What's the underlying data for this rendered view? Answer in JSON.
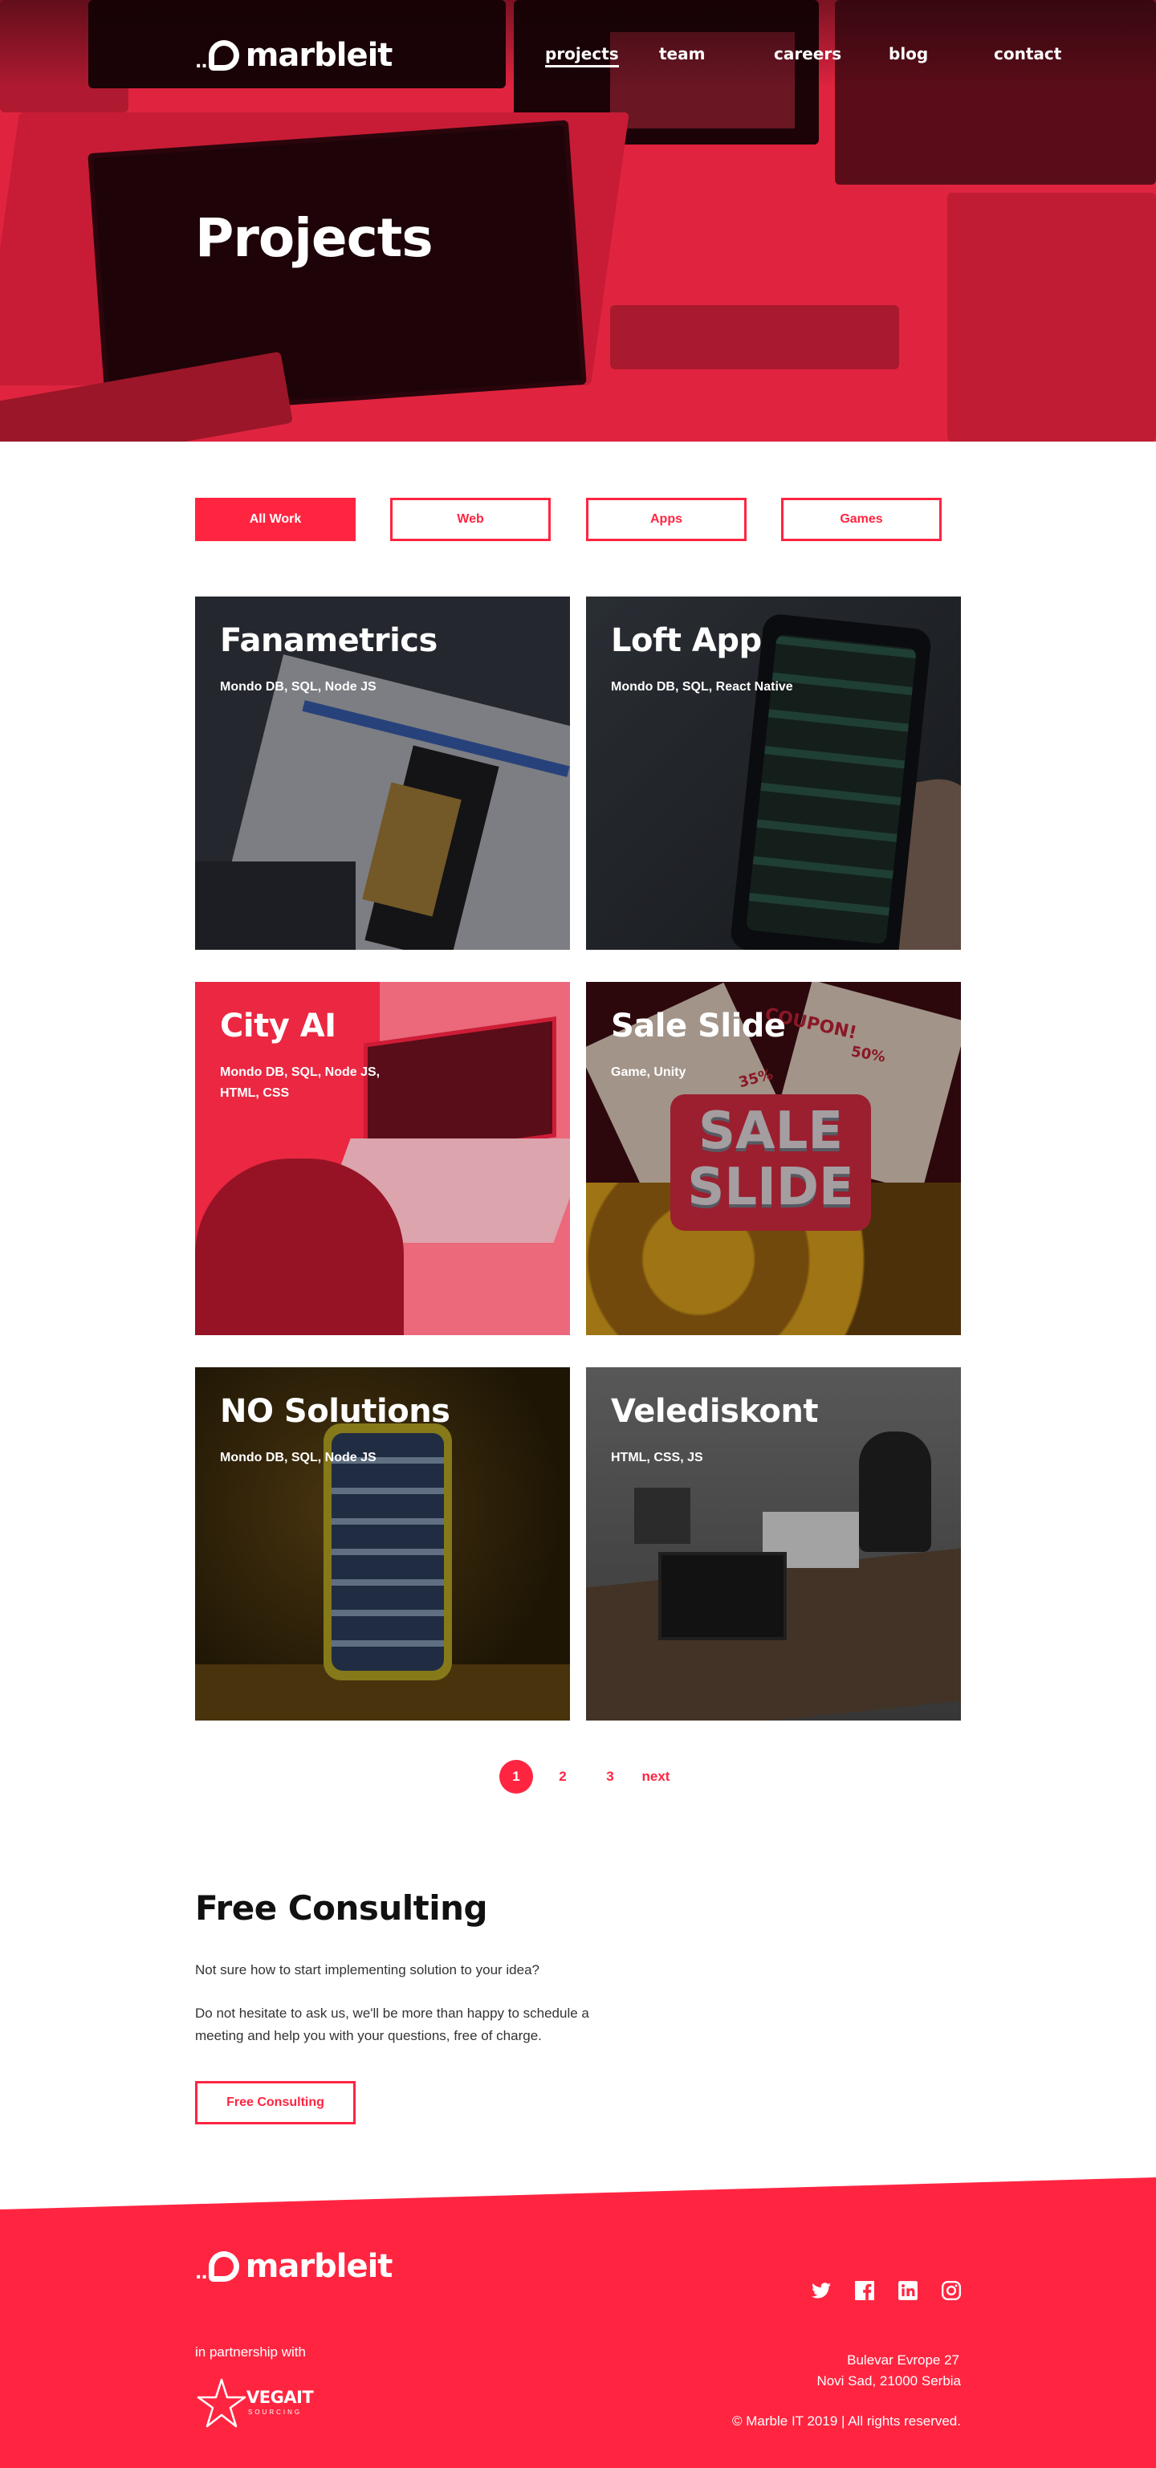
{
  "brand": {
    "name": "marbleit",
    "accent": "#ff2541",
    "hero_tint": "#e0243f"
  },
  "nav": {
    "items": [
      {
        "label": "projects",
        "active": true
      },
      {
        "label": "team"
      },
      {
        "label": "careers"
      },
      {
        "label": "blog"
      },
      {
        "label": "contact"
      }
    ]
  },
  "hero": {
    "title": "Projects"
  },
  "filters": [
    {
      "label": "All Work",
      "active": true
    },
    {
      "label": "Web"
    },
    {
      "label": "Apps"
    },
    {
      "label": "Games"
    }
  ],
  "projects": [
    {
      "title": "Fanametrics",
      "tech": "Mondo DB, SQL, Node JS"
    },
    {
      "title": "Loft App",
      "tech": "Mondo DB, SQL, React Native"
    },
    {
      "title": "City AI",
      "tech": "Mondo DB, SQL, Node JS, HTML, CSS"
    },
    {
      "title": "Sale Slide",
      "tech": "Game, Unity"
    },
    {
      "title": "NO Solutions",
      "tech": "Mondo DB, SQL, Node JS"
    },
    {
      "title": "Velediskont",
      "tech": "HTML, CSS, JS"
    }
  ],
  "pagination": {
    "pages": [
      "1",
      "2",
      "3"
    ],
    "current": "1",
    "next_label": "next"
  },
  "consulting": {
    "title": "Free Consulting",
    "p1": "Not sure how to start implementing solution to your idea?",
    "p2": "Do not hesitate to ask us, we'll be more than happy to schedule a meeting and help you with your questions, free of charge.",
    "button": "Free Consulting"
  },
  "footer": {
    "partnership": "in partnership with",
    "partner_name": "VEGAIT",
    "partner_sub": "SOURCING",
    "address_line1": "Bulevar Evrope 27",
    "address_line2": "Novi Sad, 21000 Serbia",
    "copyright": "© Marble IT 2019 | All rights reserved.",
    "social_icons": [
      "twitter-icon",
      "facebook-icon",
      "linkedin-icon",
      "instagram-icon"
    ]
  },
  "sale_slide_art": {
    "line1": "SALE",
    "line2": "SLIDE",
    "coupon": "COUPON!",
    "pct1": "50%",
    "pct2": "35%"
  }
}
